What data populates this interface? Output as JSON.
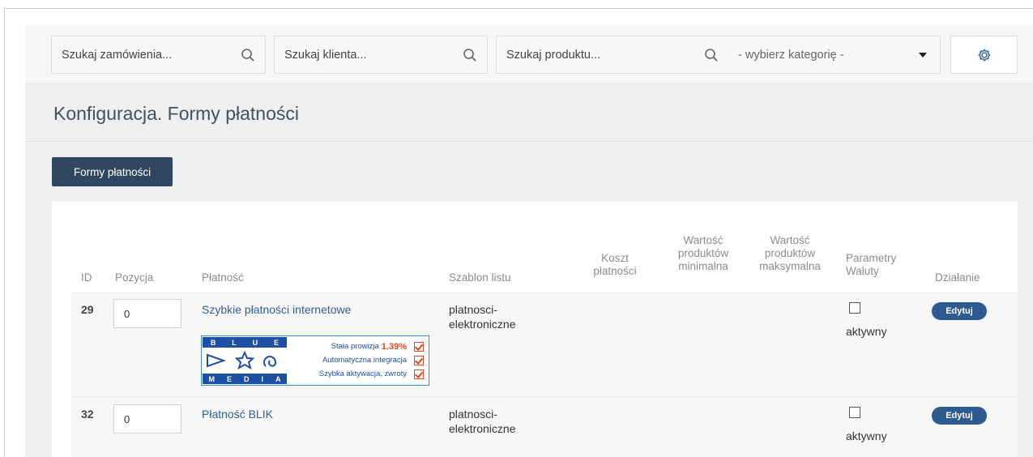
{
  "search": {
    "orders_placeholder": "Szukaj zamówienia...",
    "clients_placeholder": "Szukaj klienta...",
    "products_placeholder": "Szukaj produktu...",
    "category_selected": "- wybierz kategorię -"
  },
  "page": {
    "title": "Konfiguracja. Formy płatności",
    "tab_label": "Formy płatności"
  },
  "table": {
    "headers": {
      "id": "ID",
      "position": "Pozycja",
      "payment": "Płatność",
      "template": "Szablon listu",
      "cost_l1": "Koszt",
      "cost_l2": "płatności",
      "min_l1": "Wartość",
      "min_l2": "produktów",
      "min_l3": "minimalna",
      "max_l1": "Wartość",
      "max_l2": "produktów",
      "max_l3": "maksymalna",
      "params_l1": "Parametry",
      "params_l2": "Waluty",
      "action": "Działanie"
    },
    "rows": [
      {
        "id": "29",
        "position": "0",
        "name": "Szybkie płatności internetowe",
        "template_l1": "platnosci-",
        "template_l2": "elektroniczne",
        "active_label": "aktywny",
        "active": false,
        "action_label": "Edytuj"
      },
      {
        "id": "32",
        "position": "0",
        "name": "Płatność BLIK",
        "template_l1": "platnosci-",
        "template_l2": "elektroniczne",
        "active_label": "aktywny",
        "active": false,
        "action_label": "Edytuj"
      }
    ]
  },
  "banner": {
    "logo_top": [
      "B",
      "L",
      "U",
      "E"
    ],
    "logo_bottom": [
      "M",
      "E",
      "D",
      "I",
      "A"
    ],
    "line1": "Stała prowizja",
    "line1_value": "1.39%",
    "line2": "Automatyczna integracja",
    "line3": "Szybka aktywacja, zwroty"
  },
  "colors": {
    "primary": "#2f4860",
    "button": "#2d5a8f",
    "link": "#2f5f93",
    "banner_blue": "#1d4fa3",
    "banner_accent": "#e2461d"
  }
}
